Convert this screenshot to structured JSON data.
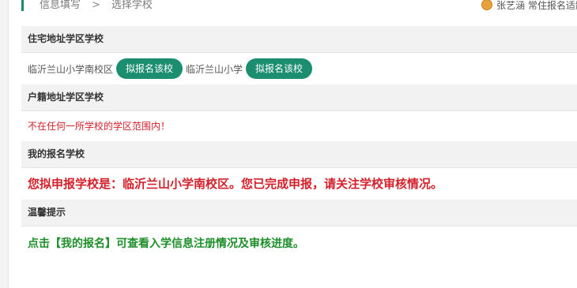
{
  "breadcrumb": {
    "step1": "信息填写",
    "separator": ">",
    "step2": "选择学校"
  },
  "user": {
    "name": "张艺涵",
    "status": "常住报名适龄"
  },
  "sections": {
    "residence": {
      "title": "住宅地址学区学校",
      "schools": [
        {
          "name": "临沂兰山小学南校区",
          "button": "拟报名该校"
        },
        {
          "name": "临沂兰山小学",
          "button": "拟报名该校"
        }
      ]
    },
    "household": {
      "title": "户籍地址学区学校",
      "message": "不在任何一所学校的学区范围内！"
    },
    "my_school": {
      "title": "我的报名学校",
      "message": "您拟申报学校是：临沂兰山小学南校区。您已完成申报，请关注学校审核情况。"
    },
    "tips": {
      "title": "温馨提示",
      "message": "点击【我的报名】可查看入学信息注册情况及审核进度。"
    }
  },
  "colors": {
    "accent": "#1b8e70",
    "error": "#d4202a",
    "success": "#1e8f2a"
  }
}
